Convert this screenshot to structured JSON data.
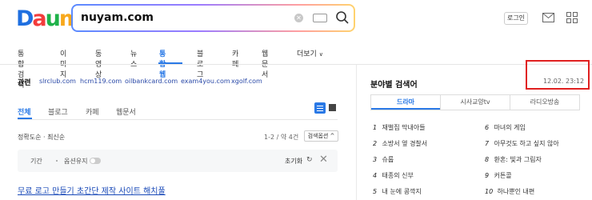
{
  "header": {
    "logo": "Daum",
    "search_value": "nuyam.com",
    "login_label": "로그인"
  },
  "nav": {
    "items": [
      "통합검색",
      "이미지",
      "동영상",
      "뉴스",
      "통합웹",
      "블로그",
      "카페",
      "웹문서",
      "더보기"
    ],
    "active_index": 4,
    "more_suffix": "∨"
  },
  "related": {
    "label": "관련",
    "links": [
      "slrclub.com",
      "hcm119.com",
      "oilbankcard.com",
      "exam4you.com",
      "xgolf.com"
    ]
  },
  "subtabs": {
    "items": [
      "전체",
      "블로그",
      "카페",
      "웹문서"
    ],
    "active_index": 0
  },
  "sort": {
    "text": "정확도순 · 최신순",
    "count": "1-2 / 약 4건",
    "option_label": "검색옵션 ^"
  },
  "filter": {
    "period": "기간",
    "option": "옵션유지",
    "reset": "초기화",
    "reset_icon": "↻",
    "close": "✕"
  },
  "results": [
    {
      "title": "무료 로고 만들기 초간단 제작 사이트 해치풀"
    }
  ],
  "realtime": {
    "title": "분야별 검색어",
    "timestamp": "12.02. 23:12",
    "tabs": [
      "드라마",
      "시사교양tv",
      "라디오방송"
    ],
    "active_tab": 0,
    "items": [
      {
        "num": "1",
        "text": "재벌집 막내아들"
      },
      {
        "num": "2",
        "text": "소방서 옆 경찰서"
      },
      {
        "num": "3",
        "text": "슈룹"
      },
      {
        "num": "4",
        "text": "태종의 신부"
      },
      {
        "num": "5",
        "text": "내 눈에 콩깍지"
      },
      {
        "num": "6",
        "text": "마녀의 게임"
      },
      {
        "num": "7",
        "text": "아무것도 하고 싶지 않아"
      },
      {
        "num": "8",
        "text": "환혼: 빛과 그림자"
      },
      {
        "num": "9",
        "text": "커튼콜"
      },
      {
        "num": "10",
        "text": "하나뿐인 내편"
      }
    ]
  },
  "colors": {
    "accent": "#2a79e6",
    "link": "#2b4aa8",
    "highlight_box": "#e02020"
  }
}
